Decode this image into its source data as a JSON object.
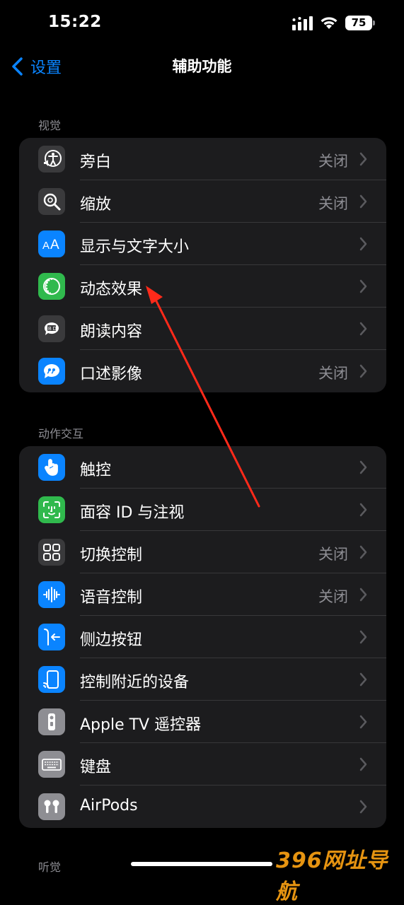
{
  "status_bar": {
    "time": "15:22",
    "battery": "75"
  },
  "nav": {
    "back_label": "设置",
    "title": "辅助功能"
  },
  "sections": [
    {
      "header": "视觉",
      "rows": [
        {
          "label": "旁白",
          "value": "关闭",
          "icon": "voiceover-icon",
          "color": "#3a3a3c"
        },
        {
          "label": "缩放",
          "value": "关闭",
          "icon": "zoom-icon",
          "color": "#3a3a3c"
        },
        {
          "label": "显示与文字大小",
          "value": "",
          "icon": "text-size-icon",
          "color": "#0a84ff"
        },
        {
          "label": "动态效果",
          "value": "",
          "icon": "motion-icon",
          "color": "#30b94d"
        },
        {
          "label": "朗读内容",
          "value": "",
          "icon": "spoken-content-icon",
          "color": "#3a3a3c"
        },
        {
          "label": "口述影像",
          "value": "关闭",
          "icon": "audio-description-icon",
          "color": "#0a84ff"
        }
      ]
    },
    {
      "header": "动作交互",
      "rows": [
        {
          "label": "触控",
          "value": "",
          "icon": "touch-icon",
          "color": "#0a84ff"
        },
        {
          "label": "面容 ID 与注视",
          "value": "",
          "icon": "face-id-icon",
          "color": "#30b94d"
        },
        {
          "label": "切换控制",
          "value": "关闭",
          "icon": "switch-control-icon",
          "color": "#3a3a3c"
        },
        {
          "label": "语音控制",
          "value": "关闭",
          "icon": "voice-control-icon",
          "color": "#0a84ff"
        },
        {
          "label": "侧边按钮",
          "value": "",
          "icon": "side-button-icon",
          "color": "#0a84ff"
        },
        {
          "label": "控制附近的设备",
          "value": "",
          "icon": "nearby-devices-icon",
          "color": "#0a84ff"
        },
        {
          "label": "Apple TV 遥控器",
          "value": "",
          "icon": "apple-tv-remote-icon",
          "color": "#8e8e93"
        },
        {
          "label": "键盘",
          "value": "",
          "icon": "keyboard-icon",
          "color": "#8e8e93"
        },
        {
          "label": "AirPods",
          "value": "",
          "icon": "airpods-icon",
          "color": "#8e8e93"
        }
      ]
    }
  ],
  "next_section_header": "听觉",
  "watermark": "396网址导航"
}
